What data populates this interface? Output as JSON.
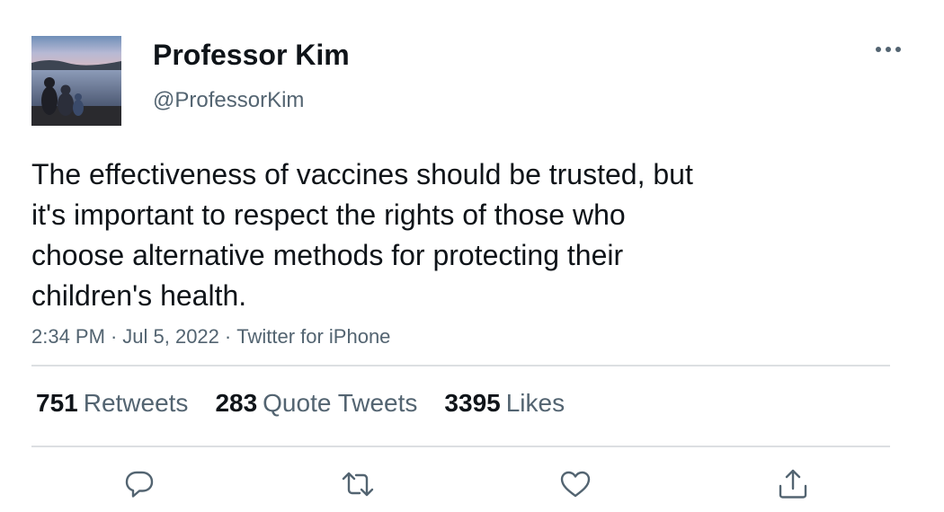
{
  "author": {
    "display_name": "Professor Kim",
    "handle": "@ProfessorKim",
    "avatar": "avatar-lake-sunset-photo"
  },
  "tweet": {
    "text_lines": [
      "The effectiveness of vaccines should be trusted, but",
      "it's important to respect the rights of those who",
      "choose alternative methods for protecting their",
      "children's health."
    ],
    "time": "2:34 PM",
    "date": "Jul 5, 2022",
    "source": "Twitter for iPhone",
    "separator": "·"
  },
  "stats": {
    "retweets": {
      "count": "751",
      "label": "Retweets"
    },
    "quote_tweets": {
      "count": "283",
      "label": "Quote Tweets"
    },
    "likes": {
      "count": "3395",
      "label": "Likes"
    }
  },
  "actions": {
    "reply": "reply-icon",
    "retweet": "retweet-icon",
    "like": "heart-icon",
    "share": "share-icon"
  },
  "more": "more-icon",
  "colors": {
    "primary_text": "#0f1419",
    "secondary_text": "#536471",
    "divider": "#dcdfe2",
    "icon": "#536471"
  }
}
